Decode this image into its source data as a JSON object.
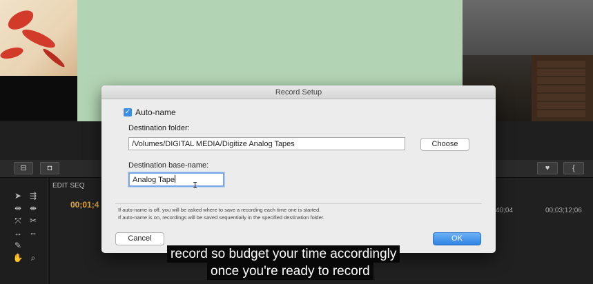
{
  "dialog": {
    "title": "Record Setup",
    "auto_name_label": "Auto-name",
    "auto_name_checked": true,
    "destination_folder_label": "Destination folder:",
    "destination_folder_value": "/Volumes/DIGITAL MEDIA/Digitize Analog Tapes",
    "choose_label": "Choose",
    "base_name_label": "Destination base-name:",
    "base_name_value": "Analog Tape",
    "info_line_1": "If auto-name is off, you will be asked where to save a recording each time one is started.",
    "info_line_2": "If auto-name is on, recordings will be saved sequentially in the specified destination folder.",
    "cancel_label": "Cancel",
    "ok_label": "OK"
  },
  "editor": {
    "sequence_tab": "EDIT SEQ",
    "timecode": "00;01;4",
    "ruler_label_1": "40;04",
    "ruler_label_2": "00;03;12;06"
  },
  "captions": {
    "line_1": "record so budget your time accordingly",
    "line_2": "once you're ready to record"
  },
  "colors": {
    "accent": "#2f83e4",
    "timecode": "#e2a63a",
    "preview_green": "#b3d4b4"
  },
  "icons": [
    "check-icon",
    "selection-tool-icon",
    "track-select-icon",
    "ripple-edit-icon",
    "razor-icon",
    "slip-icon",
    "pen-icon",
    "hand-icon",
    "zoom-icon",
    "camera-icon",
    "marker-icon"
  ]
}
